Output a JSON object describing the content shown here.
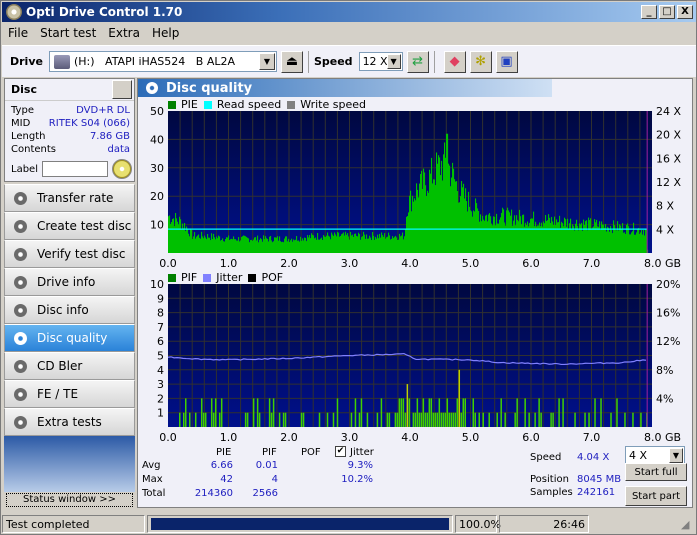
{
  "window": {
    "title": "Opti Drive Control 1.70",
    "minimize": "_",
    "maximize": "□",
    "close": "X"
  },
  "menu": [
    {
      "label": "File"
    },
    {
      "label": "Start test"
    },
    {
      "label": "Extra"
    },
    {
      "label": "Help"
    }
  ],
  "toolbar": {
    "drive_label": "Drive",
    "drive_value": "(H:)   ATAPI iHAS524   B AL2A",
    "speed_label": "Speed",
    "speed_value": "12 X"
  },
  "disc": {
    "title": "Disc",
    "rows": [
      {
        "k": "Type",
        "v": "DVD+R DL"
      },
      {
        "k": "MID",
        "v": "RITEK S04 (066)"
      },
      {
        "k": "Length",
        "v": "7.86 GB"
      },
      {
        "k": "Contents",
        "v": "data"
      }
    ],
    "label_label": "Label",
    "label_value": ""
  },
  "nav": [
    {
      "label": "Transfer rate"
    },
    {
      "label": "Create test disc"
    },
    {
      "label": "Verify test disc"
    },
    {
      "label": "Drive info"
    },
    {
      "label": "Disc info"
    },
    {
      "label": "Disc quality",
      "active": true
    },
    {
      "label": "CD Bler"
    },
    {
      "label": "FE / TE"
    },
    {
      "label": "Extra tests"
    }
  ],
  "status_window_label": "Status window >>",
  "main": {
    "title": "Disc quality"
  },
  "colors": {
    "pie": "#00c000",
    "read_speed": "#00ffff",
    "write_speed": "#808080",
    "pif": "#40d000",
    "jitter": "#8080ff",
    "pof": "#000000",
    "plot_bg_top": "#000840",
    "plot_bg_bottom": "#00108c",
    "grid": "#303030"
  },
  "chart_data": [
    {
      "type": "bar",
      "title": "PIE",
      "legend": [
        "PIE",
        "Read speed",
        "Write speed"
      ],
      "xlabel": "GB",
      "xlim": [
        0,
        8.0
      ],
      "ylim": [
        0,
        50
      ],
      "y2lim": [
        0,
        24
      ],
      "xticks": [
        "0.0",
        "1.0",
        "2.0",
        "3.0",
        "4.0",
        "5.0",
        "6.0",
        "7.0",
        "8.0 GB"
      ],
      "yticks": [
        "10",
        "20",
        "30",
        "40",
        "50"
      ],
      "y2ticks": [
        "4 X",
        "8 X",
        "12 X",
        "16 X",
        "20 X",
        "24 X"
      ],
      "pie_profile": [
        [
          0,
          13
        ],
        [
          0.1,
          12
        ],
        [
          0.2,
          11
        ],
        [
          0.3,
          9
        ],
        [
          0.4,
          6
        ],
        [
          0.6,
          6
        ],
        [
          1.0,
          5
        ],
        [
          1.5,
          5
        ],
        [
          2.0,
          5
        ],
        [
          2.5,
          6
        ],
        [
          3.0,
          6
        ],
        [
          3.5,
          6
        ],
        [
          3.9,
          6
        ],
        [
          3.95,
          17
        ],
        [
          4.1,
          22
        ],
        [
          4.3,
          26
        ],
        [
          4.5,
          31
        ],
        [
          4.6,
          32
        ],
        [
          4.8,
          22
        ],
        [
          5.0,
          17
        ],
        [
          5.2,
          13
        ],
        [
          5.5,
          13
        ],
        [
          6.0,
          12
        ],
        [
          6.5,
          11
        ],
        [
          7.0,
          10
        ],
        [
          7.5,
          9
        ],
        [
          7.9,
          8
        ],
        [
          7.92,
          0
        ]
      ],
      "pie_max": 42,
      "read_speed_x": 4.04
    },
    {
      "type": "bar",
      "title": "PIF / Jitter",
      "legend": [
        "PIF",
        "Jitter",
        "POF"
      ],
      "xlabel": "GB",
      "xlim": [
        0,
        8.0
      ],
      "ylim": [
        0,
        10
      ],
      "y2lim": [
        0,
        20
      ],
      "xticks": [
        "0.0",
        "1.0",
        "2.0",
        "3.0",
        "4.0",
        "5.0",
        "6.0",
        "7.0",
        "8.0 GB"
      ],
      "yticks": [
        "1",
        "2",
        "3",
        "4",
        "5",
        "6",
        "7",
        "8",
        "9",
        "10"
      ],
      "y2ticks": [
        "4%",
        "8%",
        "12%",
        "16%",
        "20%"
      ],
      "jitter_profile": [
        [
          0,
          9.8
        ],
        [
          0.5,
          9.5
        ],
        [
          1.0,
          9.4
        ],
        [
          2.0,
          9.6
        ],
        [
          3.0,
          10.0
        ],
        [
          3.9,
          10.2
        ],
        [
          4.1,
          9.5
        ],
        [
          5.0,
          9.4
        ],
        [
          5.5,
          9.0
        ],
        [
          6.5,
          8.8
        ],
        [
          7.5,
          9.0
        ],
        [
          7.9,
          9.4
        ]
      ],
      "pif_max": 4,
      "pif_spike_x": 4.8
    }
  ],
  "stats": {
    "headers": [
      "PIE",
      "PIF",
      "POF",
      "Jitter"
    ],
    "jitter_checked": true,
    "rows": [
      {
        "label": "Avg",
        "pie": "6.66",
        "pif": "0.01",
        "pof": "",
        "jitter": "9.3%"
      },
      {
        "label": "Max",
        "pie": "42",
        "pif": "4",
        "pof": "",
        "jitter": "10.2%"
      },
      {
        "label": "Total",
        "pie": "214360",
        "pif": "2566",
        "pof": "",
        "jitter": ""
      }
    ]
  },
  "info": {
    "speed_label": "Speed",
    "speed_value": "4.04 X",
    "position_label": "Position",
    "position_value": "8045 MB",
    "samples_label": "Samples",
    "samples_value": "242161",
    "speed_select": "4 X",
    "start_full": "Start full",
    "start_part": "Start part"
  },
  "statusbar": {
    "text": "Test completed",
    "progress": 100,
    "progress_label": "100.0%",
    "time": "26:46"
  }
}
